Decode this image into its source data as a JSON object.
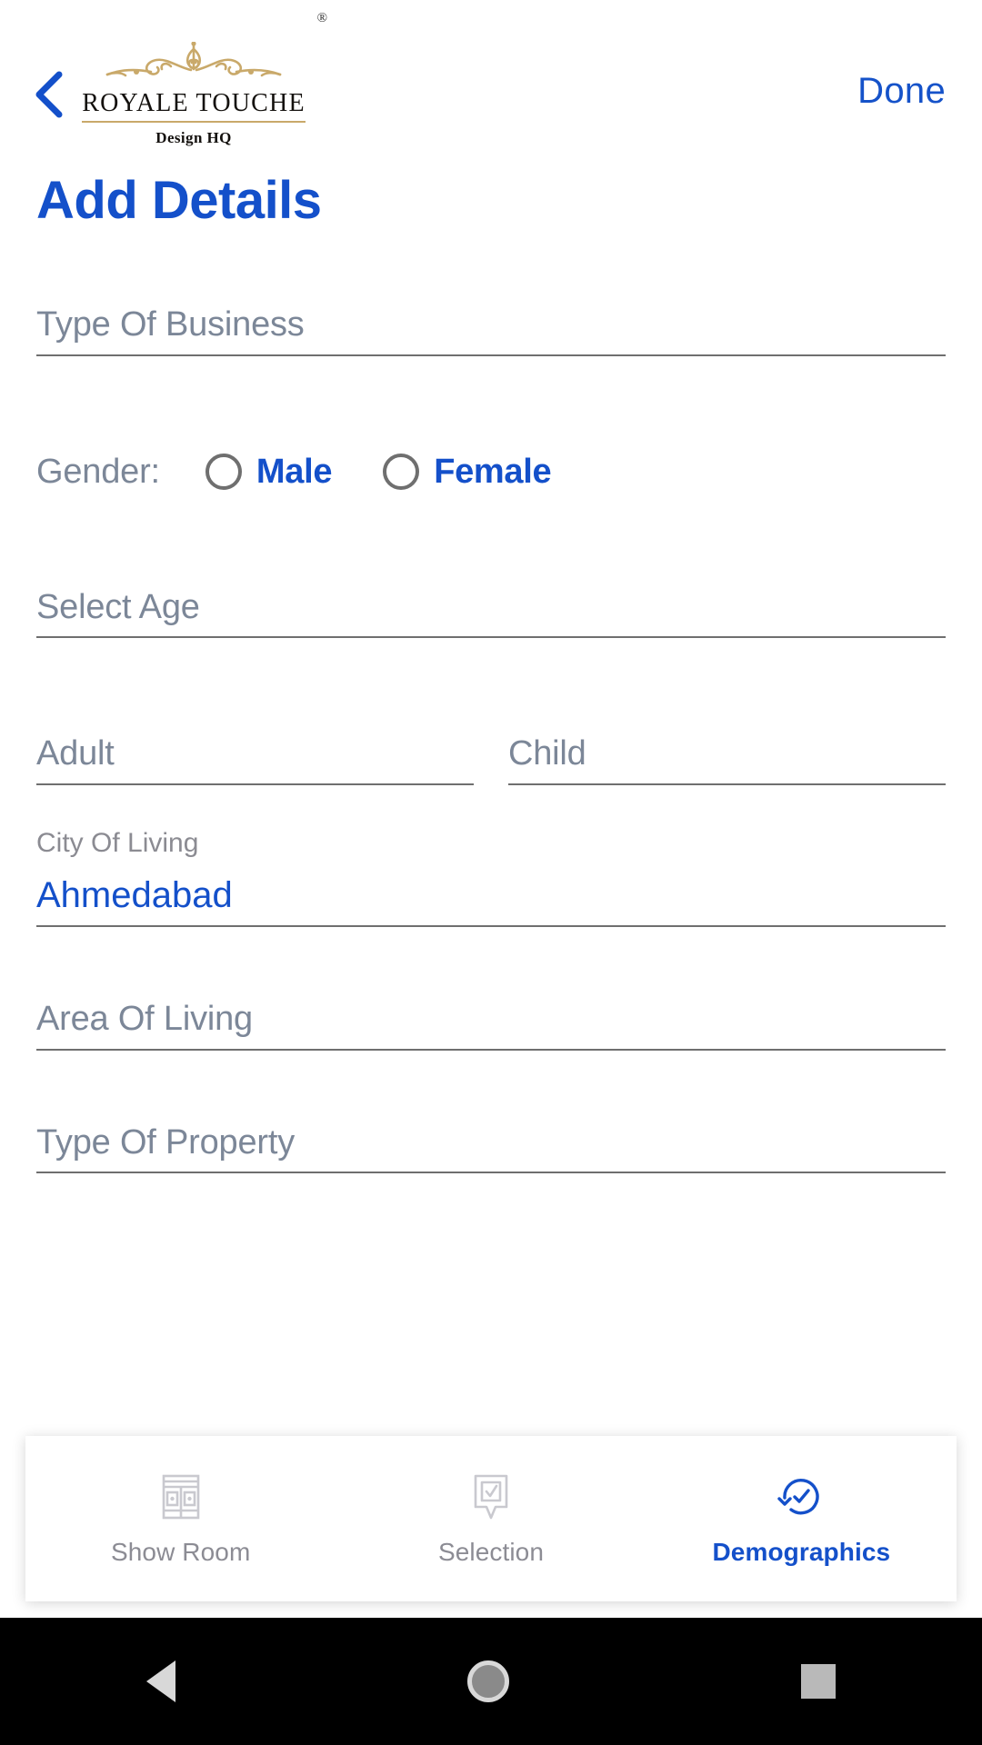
{
  "header": {
    "back_icon": "chevron-left-icon",
    "logo": {
      "brand": "ROYALE TOUCHE",
      "registered_mark": "®",
      "tagline": "Design HQ",
      "ornament_color": "#c9a96a"
    },
    "done_label": "Done"
  },
  "page": {
    "title": "Add Details",
    "accent_color": "#1450ca",
    "placeholder_color": "#7c8798",
    "underline_color": "#6f6f6f"
  },
  "form": {
    "type_of_business": {
      "placeholder": "Type Of Business",
      "value": ""
    },
    "gender": {
      "label": "Gender:",
      "options": [
        {
          "label": "Male",
          "selected": false
        },
        {
          "label": "Female",
          "selected": false
        }
      ]
    },
    "select_age": {
      "placeholder": "Select Age",
      "value": ""
    },
    "adult": {
      "placeholder": "Adult",
      "value": ""
    },
    "child": {
      "placeholder": "Child",
      "value": ""
    },
    "city_of_living": {
      "label": "City Of Living",
      "value": "Ahmedabad"
    },
    "area_of_living": {
      "placeholder": "Area Of Living",
      "value": ""
    },
    "type_of_property": {
      "placeholder": "Type Of Property",
      "value": ""
    }
  },
  "tabbar": {
    "tabs": [
      {
        "label": "Show Room",
        "icon": "storefront-icon",
        "active": false
      },
      {
        "label": "Selection",
        "icon": "comment-check-icon",
        "active": false
      },
      {
        "label": "Demographics",
        "icon": "circular-arrow-check-icon",
        "active": true
      }
    ]
  },
  "system_nav": {
    "back": "back-triangle-icon",
    "home": "home-circle-icon",
    "recents": "recents-square-icon"
  }
}
